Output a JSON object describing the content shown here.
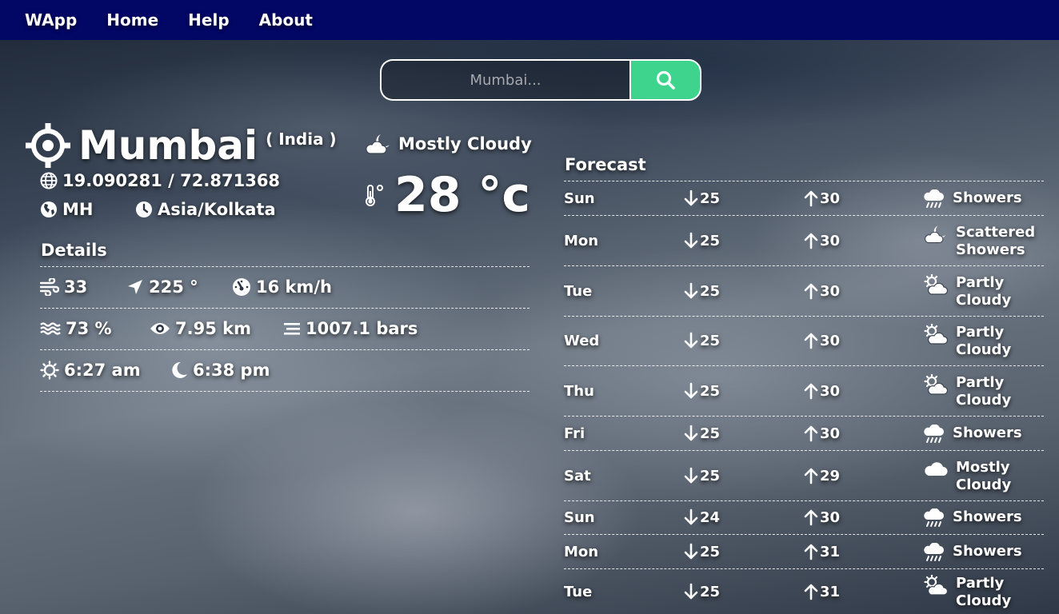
{
  "nav": {
    "brand": "WApp",
    "links": [
      "Home",
      "Help",
      "About"
    ]
  },
  "search": {
    "placeholder": "Mumbai..."
  },
  "location": {
    "city": "Mumbai",
    "country": "( India )",
    "coordinates": "19.090281 / 72.871368",
    "region": "MH",
    "timezone": "Asia/Kolkata"
  },
  "details": {
    "title": "Details",
    "wind_level": "33",
    "wind_direction": "225 °",
    "wind_speed": "16 km/h",
    "humidity": "73 %",
    "visibility": "7.95 km",
    "pressure": "1007.1 bars",
    "sunrise": "6:27 am",
    "sunset": "6:38 pm"
  },
  "current": {
    "condition": "Mostly Cloudy",
    "temperature": "28 °c",
    "condition_icon": "moon-cloud-icon"
  },
  "forecast": {
    "title": "Forecast",
    "days": [
      {
        "day": "Sun",
        "low": "25",
        "high": "30",
        "condition": "Showers",
        "icon": "showers-icon"
      },
      {
        "day": "Mon",
        "low": "25",
        "high": "30",
        "condition": "Scattered Showers",
        "icon": "moon-cloud-icon"
      },
      {
        "day": "Tue",
        "low": "25",
        "high": "30",
        "condition": "Partly Cloudy",
        "icon": "sun-cloud-icon"
      },
      {
        "day": "Wed",
        "low": "25",
        "high": "30",
        "condition": "Partly Cloudy",
        "icon": "sun-cloud-icon"
      },
      {
        "day": "Thu",
        "low": "25",
        "high": "30",
        "condition": "Partly Cloudy",
        "icon": "sun-cloud-icon"
      },
      {
        "day": "Fri",
        "low": "25",
        "high": "30",
        "condition": "Showers",
        "icon": "showers-icon"
      },
      {
        "day": "Sat",
        "low": "25",
        "high": "29",
        "condition": "Mostly Cloudy",
        "icon": "cloud-icon"
      },
      {
        "day": "Sun",
        "low": "24",
        "high": "30",
        "condition": "Showers",
        "icon": "showers-icon"
      },
      {
        "day": "Mon",
        "low": "25",
        "high": "31",
        "condition": "Showers",
        "icon": "showers-icon"
      },
      {
        "day": "Tue",
        "low": "25",
        "high": "31",
        "condition": "Partly Cloudy",
        "icon": "sun-cloud-icon"
      }
    ]
  },
  "colors": {
    "navbar": "#020664",
    "search_button": "#3fd48d"
  }
}
